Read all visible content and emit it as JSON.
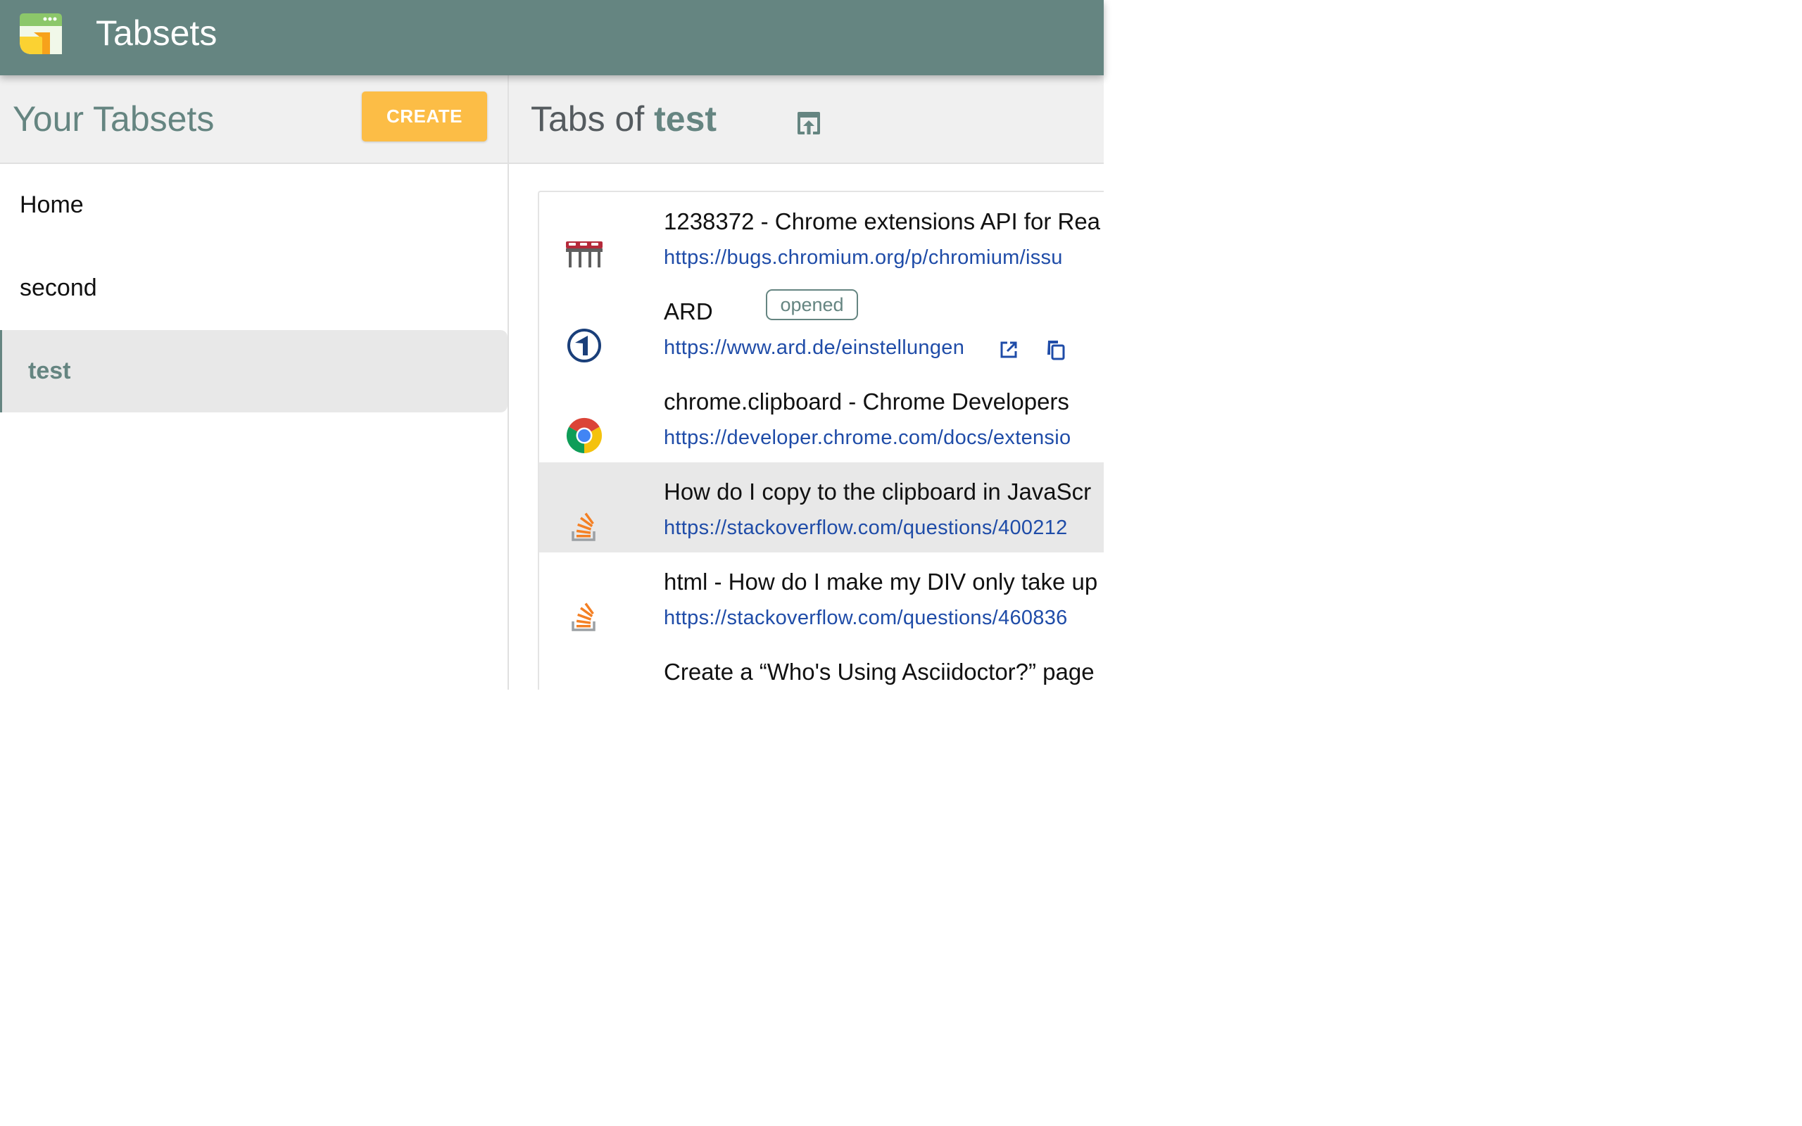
{
  "app": {
    "title": "Tabsets",
    "logo_icon": "tabsets-logo-icon"
  },
  "sidebar": {
    "title": "Your Tabsets",
    "create_label": "CREATE",
    "items": [
      {
        "label": "Home",
        "active": false
      },
      {
        "label": "second",
        "active": false
      },
      {
        "label": "test",
        "active": true
      }
    ]
  },
  "main": {
    "title_prefix": "Tabs of",
    "tabset_name": "test",
    "open_all_icon": "open-in-browser-icon",
    "tabs": [
      {
        "title": "1238372 - Chrome extensions API for Rea",
        "url": "https://bugs.chromium.org/p/chromium/issu",
        "favicon": "chromium-bugs-icon"
      },
      {
        "title": "ARD",
        "url": "https://www.ard.de/einstellungen",
        "badge": "opened",
        "favicon": "ard-icon"
      },
      {
        "title": "chrome.clipboard - Chrome Developers",
        "url": "https://developer.chrome.com/docs/extensio",
        "favicon": "chrome-icon"
      },
      {
        "title": "How do I copy to the clipboard in JavaScr",
        "url": "https://stackoverflow.com/questions/400212",
        "favicon": "stackoverflow-icon"
      },
      {
        "title": "html - How do I make my DIV only take up",
        "url": "https://stackoverflow.com/questions/460836",
        "favicon": "stackoverflow-icon"
      },
      {
        "title": "Create a “Who's Using Asciidoctor?” page",
        "url": "",
        "favicon": ""
      }
    ]
  },
  "colors": {
    "app_bar": "#658581",
    "accent": "#658581",
    "create_button": "#fcbd46",
    "link": "#1f4ca8",
    "hover_row": "#e8e8e8",
    "header_bg": "#f0f0f0"
  }
}
